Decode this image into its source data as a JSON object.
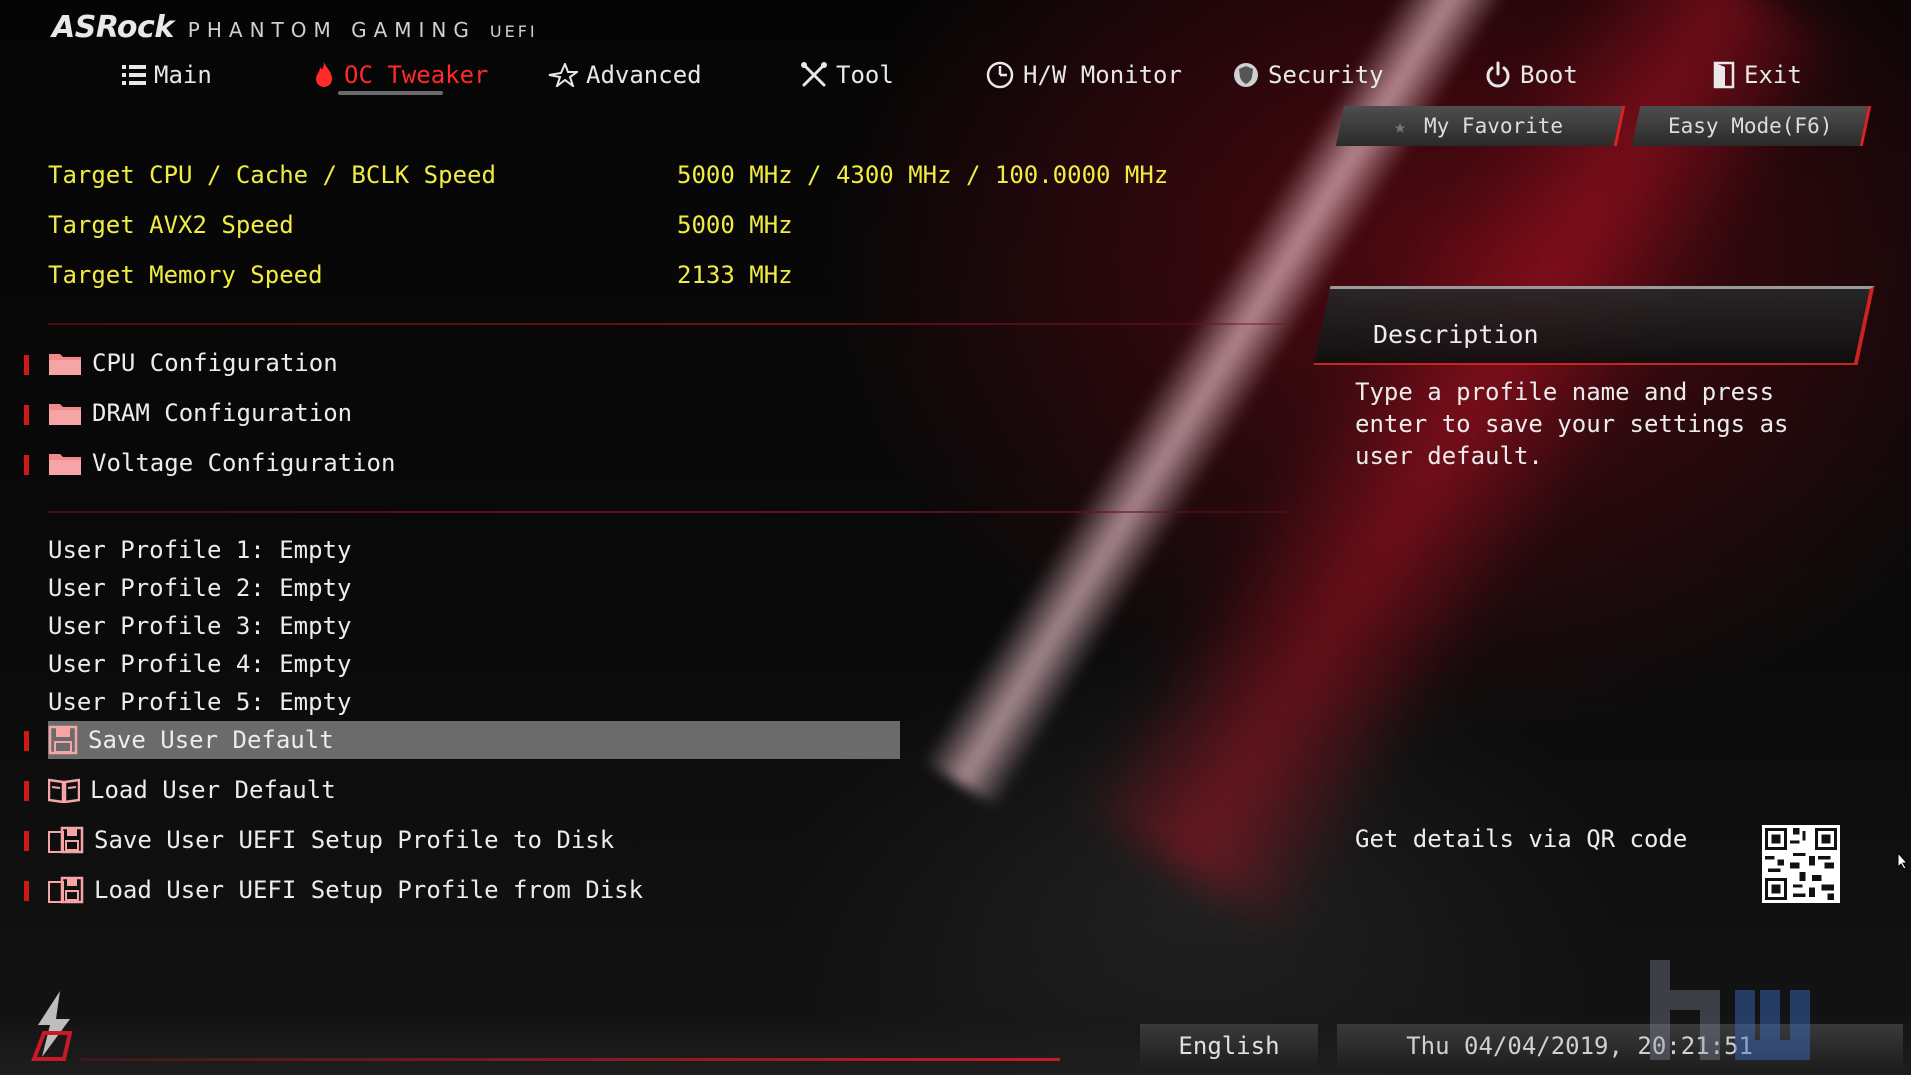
{
  "brand": {
    "logo": "ASRock",
    "product": "PHANTOM GAMING",
    "uefi": "UEFI"
  },
  "nav": {
    "items": [
      {
        "label": "Main",
        "icon": "list-icon"
      },
      {
        "label": "OC Tweaker",
        "icon": "flame-icon",
        "active": true
      },
      {
        "label": "Advanced",
        "icon": "star-icon"
      },
      {
        "label": "Tool",
        "icon": "tools-icon"
      },
      {
        "label": "H/W Monitor",
        "icon": "monitor-gauge-icon"
      },
      {
        "label": "Security",
        "icon": "shield-icon"
      },
      {
        "label": "Boot",
        "icon": "power-icon"
      },
      {
        "label": "Exit",
        "icon": "exit-door-icon"
      }
    ]
  },
  "buttons": {
    "favorite": "My Favorite",
    "easy_mode": "Easy Mode(F6)"
  },
  "info": [
    {
      "label": "Target CPU / Cache / BCLK Speed",
      "value": "5000 MHz / 4300 MHz / 100.0000 MHz"
    },
    {
      "label": "Target AVX2 Speed",
      "value": "5000 MHz"
    },
    {
      "label": "Target Memory Speed",
      "value": "2133 MHz"
    }
  ],
  "config_menu": [
    {
      "label": "CPU Configuration"
    },
    {
      "label": "DRAM Configuration"
    },
    {
      "label": "Voltage Configuration"
    }
  ],
  "profiles": [
    "User Profile 1: Empty",
    "User Profile 2: Empty",
    "User Profile 3: Empty",
    "User Profile 4: Empty",
    "User Profile 5: Empty"
  ],
  "actions": [
    {
      "label": "Save User Default",
      "selected": true
    },
    {
      "label": "Load User Default"
    },
    {
      "label": "Save User UEFI Setup Profile to Disk"
    },
    {
      "label": "Load User UEFI Setup Profile from Disk"
    }
  ],
  "description": {
    "title": "Description",
    "text": "Type a profile name and press enter to save your settings as user default."
  },
  "qr": {
    "label": "Get details via QR code"
  },
  "footer": {
    "language": "English",
    "datetime": "Thu 04/04/2019, 20:21:51"
  },
  "colors": {
    "accent_red": "#ff2a2a",
    "value_yellow": "#f1ec43",
    "marker_red": "#d01818",
    "selected_bg": "#6b6b6b"
  }
}
